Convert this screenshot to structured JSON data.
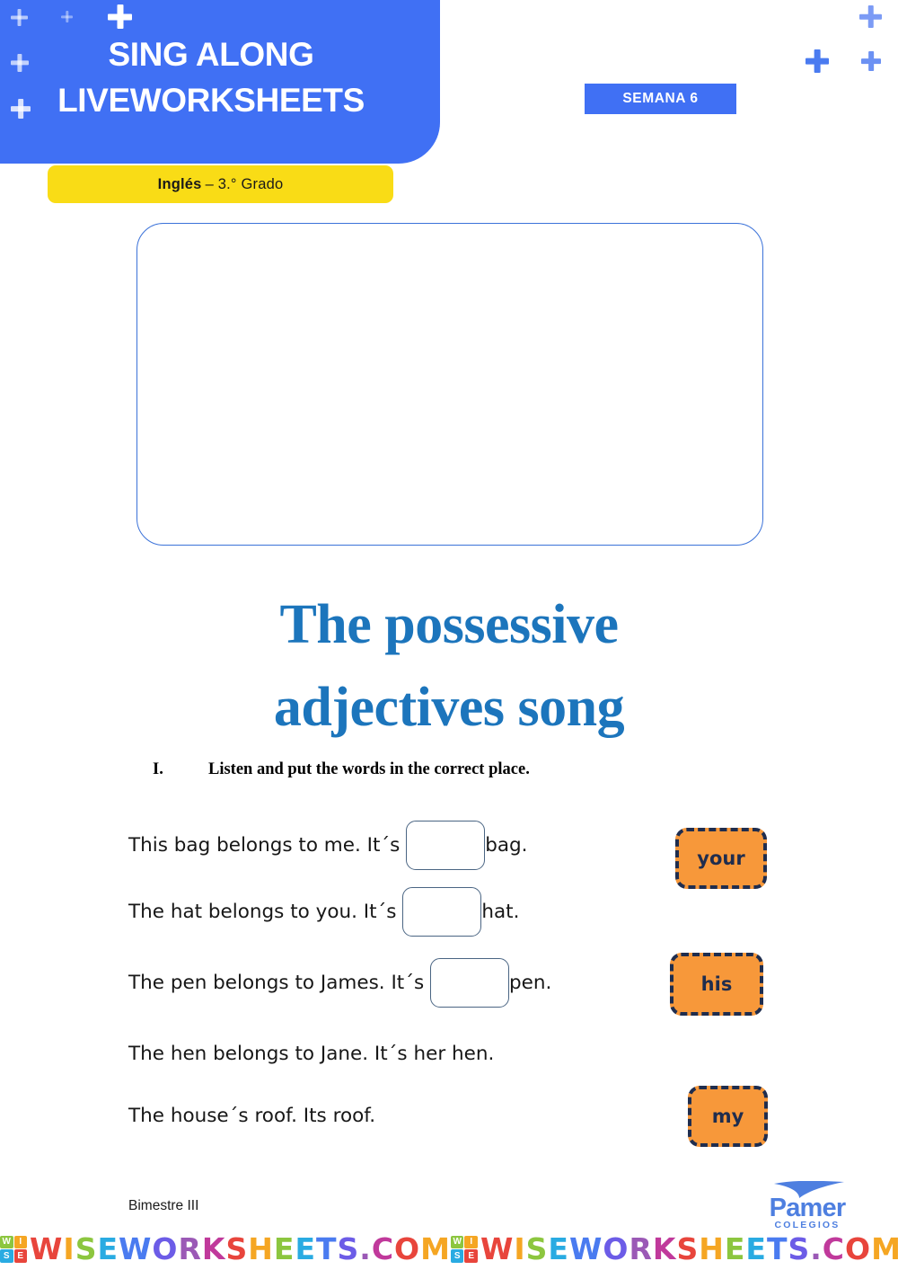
{
  "header": {
    "title_line1": "SING ALONG",
    "title_line2": "LIVEWORKSHEETS",
    "bg_color": "#4070F4",
    "grade_subject": "Inglés",
    "grade_rest": " – 3.° Grado",
    "grade_badge_color": "#F9DC16",
    "week_badge": "SEMANA 6"
  },
  "media": {
    "border_color": "#3B72D9",
    "content": ""
  },
  "worksheet": {
    "title_line1": "The possessive",
    "title_line2": "adjectives song",
    "title_color": "#1C75BC",
    "exercise_number": "I.",
    "instruction": "Listen and put the words in the correct place."
  },
  "sentences": [
    {
      "before": "This bag belongs to me. It´s ",
      "has_box": true,
      "after": "bag."
    },
    {
      "before": "The hat belongs to you. It´s ",
      "has_box": true,
      "after": "hat."
    },
    {
      "before": "The pen belongs to James. It´s ",
      "has_box": true,
      "after": "pen."
    },
    {
      "before": "The hen belongs to Jane. It´s her hen.",
      "has_box": false,
      "after": ""
    },
    {
      "before": "The house´s roof. Its roof.",
      "has_box": false,
      "after": ""
    }
  ],
  "word_chips": [
    {
      "label": "your",
      "fill": "#F7983A",
      "border": "#1F2D4E"
    },
    {
      "label": "his",
      "fill": "#F7983A",
      "border": "#1F2D4E"
    },
    {
      "label": "my",
      "fill": "#F7983A",
      "border": "#1F2D4E"
    }
  ],
  "footer": {
    "bimester": "Bimestre III",
    "logo_word": "Pamer",
    "logo_sub": "COLEGIOS",
    "logo_color": "#4E7FE0"
  },
  "watermark": {
    "logo_letters": [
      "W",
      "I",
      "S",
      "E"
    ],
    "text": "WISEWORKSHEETS.COM"
  }
}
